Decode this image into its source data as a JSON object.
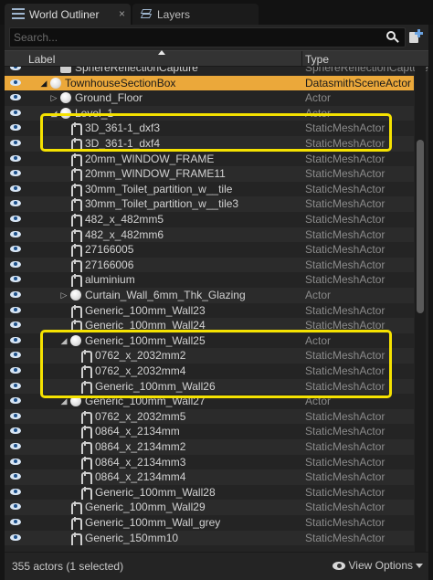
{
  "tabs": [
    {
      "label": "World Outliner",
      "close": "×",
      "icon": "outliner-icon",
      "active": true
    },
    {
      "label": "Layers",
      "icon": "layers-icon",
      "active": false
    }
  ],
  "search": {
    "placeholder": "Search...",
    "value": ""
  },
  "columns": {
    "label": "Label",
    "type": "Type"
  },
  "rows": [
    {
      "label": "SphereReflectionCapture",
      "type": "SphereReflectionCapture",
      "depth": 1,
      "icon": "capture-icon",
      "expander": ""
    },
    {
      "label": "TownhouseSectionBox",
      "type": "DatasmithSceneActor",
      "depth": 0,
      "icon": "sphere-icon",
      "expander": "◢",
      "selected": true
    },
    {
      "label": "Ground_Floor",
      "type": "Actor",
      "depth": 1,
      "icon": "sphere-icon",
      "expander": "▷"
    },
    {
      "label": "Level_1",
      "type": "Actor",
      "depth": 1,
      "icon": "sphere-icon",
      "expander": "◢"
    },
    {
      "label": "3D_361-1_dxf3",
      "type": "StaticMeshActor",
      "depth": 2,
      "icon": "static-mesh-icon",
      "expander": ""
    },
    {
      "label": "3D_361-1_dxf4",
      "type": "StaticMeshActor",
      "depth": 2,
      "icon": "static-mesh-icon",
      "expander": ""
    },
    {
      "label": "20mm_WINDOW_FRAME",
      "type": "StaticMeshActor",
      "depth": 2,
      "icon": "static-mesh-icon",
      "expander": ""
    },
    {
      "label": "20mm_WINDOW_FRAME11",
      "type": "StaticMeshActor",
      "depth": 2,
      "icon": "static-mesh-icon",
      "expander": ""
    },
    {
      "label": "30mm_Toilet_partition_w__tile",
      "type": "StaticMeshActor",
      "depth": 2,
      "icon": "static-mesh-icon",
      "expander": ""
    },
    {
      "label": "30mm_Toilet_partition_w__tile3",
      "type": "StaticMeshActor",
      "depth": 2,
      "icon": "static-mesh-icon",
      "expander": ""
    },
    {
      "label": "482_x_482mm5",
      "type": "StaticMeshActor",
      "depth": 2,
      "icon": "static-mesh-icon",
      "expander": ""
    },
    {
      "label": "482_x_482mm6",
      "type": "StaticMeshActor",
      "depth": 2,
      "icon": "static-mesh-icon",
      "expander": ""
    },
    {
      "label": "27166005",
      "type": "StaticMeshActor",
      "depth": 2,
      "icon": "static-mesh-icon",
      "expander": ""
    },
    {
      "label": "27166006",
      "type": "StaticMeshActor",
      "depth": 2,
      "icon": "static-mesh-icon",
      "expander": ""
    },
    {
      "label": "aluminium",
      "type": "StaticMeshActor",
      "depth": 2,
      "icon": "static-mesh-icon",
      "expander": ""
    },
    {
      "label": "Curtain_Wall_6mm_Thk_Glazing",
      "type": "Actor",
      "depth": 2,
      "icon": "sphere-icon",
      "expander": "▷"
    },
    {
      "label": "Generic_100mm_Wall23",
      "type": "StaticMeshActor",
      "depth": 2,
      "icon": "static-mesh-icon",
      "expander": ""
    },
    {
      "label": "Generic_100mm_Wall24",
      "type": "StaticMeshActor",
      "depth": 2,
      "icon": "static-mesh-icon",
      "expander": ""
    },
    {
      "label": "Generic_100mm_Wall25",
      "type": "Actor",
      "depth": 2,
      "icon": "sphere-icon",
      "expander": "◢"
    },
    {
      "label": "0762_x_2032mm2",
      "type": "StaticMeshActor",
      "depth": 3,
      "icon": "static-mesh-icon",
      "expander": ""
    },
    {
      "label": "0762_x_2032mm4",
      "type": "StaticMeshActor",
      "depth": 3,
      "icon": "static-mesh-icon",
      "expander": ""
    },
    {
      "label": "Generic_100mm_Wall26",
      "type": "StaticMeshActor",
      "depth": 3,
      "icon": "static-mesh-icon",
      "expander": ""
    },
    {
      "label": "Generic_100mm_Wall27",
      "type": "Actor",
      "depth": 2,
      "icon": "sphere-icon",
      "expander": "◢"
    },
    {
      "label": "0762_x_2032mm5",
      "type": "StaticMeshActor",
      "depth": 3,
      "icon": "static-mesh-icon",
      "expander": ""
    },
    {
      "label": "0864_x_2134mm",
      "type": "StaticMeshActor",
      "depth": 3,
      "icon": "static-mesh-icon",
      "expander": ""
    },
    {
      "label": "0864_x_2134mm2",
      "type": "StaticMeshActor",
      "depth": 3,
      "icon": "static-mesh-icon",
      "expander": ""
    },
    {
      "label": "0864_x_2134mm3",
      "type": "StaticMeshActor",
      "depth": 3,
      "icon": "static-mesh-icon",
      "expander": ""
    },
    {
      "label": "0864_x_2134mm4",
      "type": "StaticMeshActor",
      "depth": 3,
      "icon": "static-mesh-icon",
      "expander": ""
    },
    {
      "label": "Generic_100mm_Wall28",
      "type": "StaticMeshActor",
      "depth": 3,
      "icon": "static-mesh-icon",
      "expander": ""
    },
    {
      "label": "Generic_100mm_Wall29",
      "type": "StaticMeshActor",
      "depth": 2,
      "icon": "static-mesh-icon",
      "expander": ""
    },
    {
      "label": "Generic_100mm_Wall_grey",
      "type": "StaticMeshActor",
      "depth": 2,
      "icon": "static-mesh-icon",
      "expander": ""
    },
    {
      "label": "Generic_150mm10",
      "type": "StaticMeshActor",
      "depth": 2,
      "icon": "static-mesh-icon",
      "expander": ""
    }
  ],
  "status": {
    "count_text": "355 actors (1 selected)",
    "view_options_label": "View Options"
  },
  "colors": {
    "selected_row": "#eba83a",
    "highlight_box": "#f5e200",
    "visibility_eye": "#d8e6f5"
  }
}
